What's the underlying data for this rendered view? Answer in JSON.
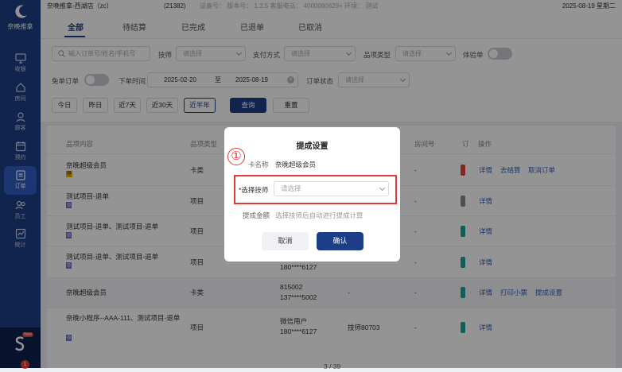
{
  "app": {
    "logo_text": "奈晚推拿"
  },
  "sidebar": {
    "items": [
      {
        "label": "收银",
        "icon": "monitor-icon"
      },
      {
        "label": "房间",
        "icon": "home-icon"
      },
      {
        "label": "顾客",
        "icon": "user-icon"
      },
      {
        "label": "预约",
        "icon": "calendar-icon"
      },
      {
        "label": "订单",
        "icon": "clipboard-icon",
        "active": true
      },
      {
        "label": "员工",
        "icon": "users-icon"
      },
      {
        "label": "统计",
        "icon": "chart-icon"
      }
    ],
    "badge_new": "New",
    "badge_count": "1"
  },
  "topbar": {
    "store": "奈晚推拿-西湖店（zc）",
    "store_id": "(21382)",
    "meta": "设备号：  版本号：  1.3.5  客服电话：  4000080629+  环境：  测试",
    "date": "2025-08-19 星期二"
  },
  "tabs": [
    "全部",
    "待结算",
    "已完成",
    "已退单",
    "已取消"
  ],
  "filters": {
    "search_placeholder": "输入订单号/姓名/手机号",
    "tech_label": "技师",
    "tech_placeholder": "请选择",
    "pay_label": "支付方式",
    "pay_placeholder": "请选择",
    "type_label": "品项类型",
    "type_placeholder": "请选择",
    "trial_label": "体验单",
    "free_label": "免单订单",
    "time_label": "下单时间",
    "date_from": "2025-02-20",
    "date_to_sep": "至",
    "date_to": "2025-08-19",
    "status_label": "订单状态",
    "status_placeholder": "请选择",
    "ranges": [
      "今日",
      "昨日",
      "近7天",
      "近30天",
      "近半年"
    ],
    "query": "查询",
    "reset": "重置"
  },
  "table": {
    "headers": [
      "品项内容",
      "品项类型",
      "房间号",
      "订",
      "操作"
    ],
    "rows": [
      {
        "item": "奈晚超级会员",
        "tag": "荐",
        "type": "卡类",
        "col3": "",
        "col4": "",
        "room": "-",
        "actions": [
          "详情",
          "去结算",
          "取消订单"
        ],
        "strip": "#e0443c"
      },
      {
        "item": "测试项目-退单",
        "tag": "◎",
        "type": "项目",
        "col3": "",
        "col4": "",
        "room": "-",
        "actions": [
          "详情"
        ],
        "strip": "#888888"
      },
      {
        "item": "测试项目-退单、测试项目-退单",
        "tag": "◎",
        "type": "项目",
        "col3": "",
        "col4": "",
        "room": "-",
        "actions": [
          "详情"
        ],
        "strip": "#1aa39a"
      },
      {
        "item": "测试项目-退单、测试项目-退单",
        "tag": "◎",
        "type": "项目",
        "col3": "180****6127",
        "col4": "",
        "room": "-",
        "actions": [
          "详情"
        ],
        "strip": "#1aa39a"
      },
      {
        "item": "奈晚超级会员",
        "tag": "",
        "type": "卡类",
        "col3": "815002\n137****5002",
        "col4": "-",
        "room": "-",
        "actions": [
          "详情",
          "打印小票",
          "提成设置"
        ],
        "strip": "#1aa39a"
      },
      {
        "item": "奈晚小程序--AAA-111、测试项目-退单",
        "tag": "◎",
        "type": "项目",
        "col3": "微信用户\n180****6127",
        "col4": "技师80703",
        "room": "-",
        "actions": [
          "详情"
        ],
        "strip": "#1aa39a"
      }
    ],
    "pagination": "3 / 39"
  },
  "modal": {
    "title": "提成设置",
    "card_label": "卡名称",
    "card_value": "奈晚超级会员",
    "tech_label": "*选择技师",
    "tech_placeholder": "请选择",
    "amount_label": "提成金额",
    "amount_hint": "选择技师后自动进行提成计算",
    "cancel": "取消",
    "confirm": "确认"
  },
  "annotation": {
    "step": "①"
  },
  "colors": {
    "brand": "#1d3e86",
    "highlight": "#e03a3a"
  }
}
